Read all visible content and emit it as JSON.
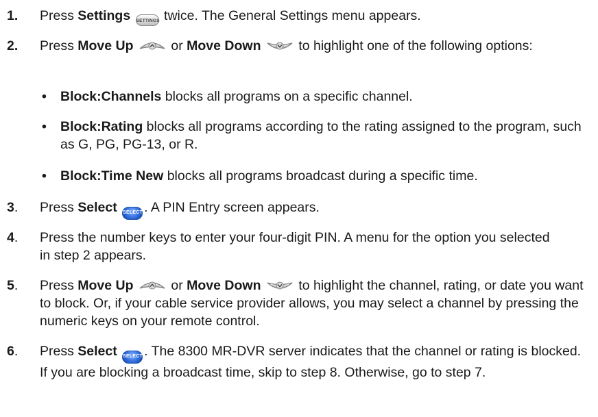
{
  "steps": [
    {
      "num": "1.",
      "pre": "Press ",
      "bold1": "Settings",
      "icon": "settings-button-icon",
      "icon_label": "SETTINGS",
      "post": " twice. The General Settings menu appears."
    },
    {
      "num": "2.",
      "pre": "Press ",
      "bold1": "Move Up",
      "mid": " or ",
      "bold2": "Move Down",
      "post": " to highlight one of the following options:",
      "bullets": [
        {
          "bold": "Block:Channels",
          "text": " blocks all programs on a specific channel."
        },
        {
          "bold": "Block:Rating",
          "text": " blocks all programs according to the rating assigned to the program, such as G, PG, PG-13, or R."
        },
        {
          "bold": "Block:Time New",
          "text": " blocks all programs broadcast during a specific time."
        }
      ]
    },
    {
      "num": "3",
      "dot": ".",
      "pre": "Press ",
      "bold1": "Select",
      "icon_label": "SELECT",
      "post": ". A PIN Entry screen appears."
    },
    {
      "num": "4",
      "dot": ".",
      "text": "Press the number keys to enter your four-digit PIN. A menu for the option you selected in step 2 appears."
    },
    {
      "num": "5",
      "dot": ".",
      "pre": "Press ",
      "bold1": "Move Up",
      "mid": " or ",
      "bold2": "Move Down",
      "post": " to highlight the channel, rating, or date you want to block. Or, if your cable service provider allows, you may select a channel by pressing the numeric keys on your remote control."
    },
    {
      "num": "6",
      "dot": ".",
      "pre": "Press ",
      "bold1": "Select",
      "icon_label": "SELECT",
      "post": ". The 8300 MR-DVR server indicates that the channel or rating is blocked. If you are blocking a broadcast time, skip to step 8. Otherwise, go to step 7."
    }
  ],
  "bullet_glyph": "•",
  "colors": {
    "select_blue": "#2a65d6",
    "text": "#1a1a1a"
  }
}
